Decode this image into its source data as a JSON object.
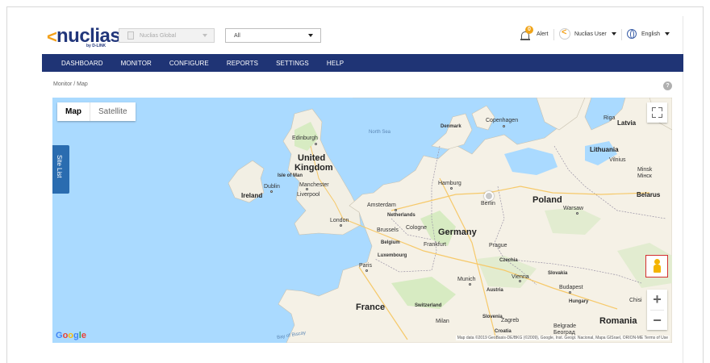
{
  "header": {
    "logo_text": "nuclias",
    "logo_sub": "by D-LINK",
    "org_select_value": "Nuclias Global",
    "site_select_value": "All",
    "alert_count": "0",
    "alert_label": "Alert",
    "user_label": "Nuclias User",
    "language_label": "English"
  },
  "nav": {
    "items": [
      "DASHBOARD",
      "MONITOR",
      "CONFIGURE",
      "REPORTS",
      "SETTINGS",
      "HELP"
    ]
  },
  "breadcrumb": "Monitor / Map",
  "help_icon_glyph": "?",
  "map": {
    "type_options": [
      "Map",
      "Satellite"
    ],
    "selected_type": "Map",
    "site_list_label": "Site List",
    "zoom_in": "+",
    "zoom_out": "−",
    "google_logo": "Google",
    "attribution": "Map data ©2019 GeoBasis-DE/BKG (©2009), Google, Inst. Geogr. Nacional, Mapa GISrael, ORION-ME   Terms of Use",
    "labels": {
      "north_sea": "North Sea",
      "bay_of_biscay": "Bay of Biscay",
      "edinburgh": "Edinburgh",
      "united": "United",
      "kingdom": "Kingdom",
      "isle_of_man": "Isle of Man",
      "dublin": "Dublin",
      "manchester": "Manchester",
      "ireland": "Ireland",
      "liverpool": "Liverpool",
      "london": "London",
      "copenhagen": "Copenhagen",
      "denmark": "Denmark",
      "hamburg": "Hamburg",
      "amsterdam": "Amsterdam",
      "netherlands": "Netherlands",
      "berlin": "Berlin",
      "poland": "Poland",
      "warsaw": "Warsaw",
      "riga": "Riga",
      "latvia": "Latvia",
      "lithuania": "Lithuania",
      "vilnius": "Vilnius",
      "minsk": "Minsk",
      "minsk_cyr": "Мінск",
      "belarus": "Belarus",
      "brussels": "Brussels",
      "cologne": "Cologne",
      "belgium": "Belgium",
      "germany": "Germany",
      "frankfurt": "Frankfurt",
      "luxembourg": "Luxembourg",
      "prague": "Prague",
      "czechia": "Czechia",
      "paris": "Paris",
      "munich": "Munich",
      "vienna": "Vienna",
      "slovakia": "Slovakia",
      "austria": "Austria",
      "budapest": "Budapest",
      "hungary": "Hungary",
      "france": "France",
      "switzerland": "Switzerland",
      "milan": "Milan",
      "slovenia": "Slovenia",
      "zagreb": "Zagreb",
      "croatia": "Croatia",
      "belgrade": "Belgrade",
      "belgrade_cyr": "Београд",
      "romania": "Romania",
      "chisi": "Chisi"
    }
  }
}
